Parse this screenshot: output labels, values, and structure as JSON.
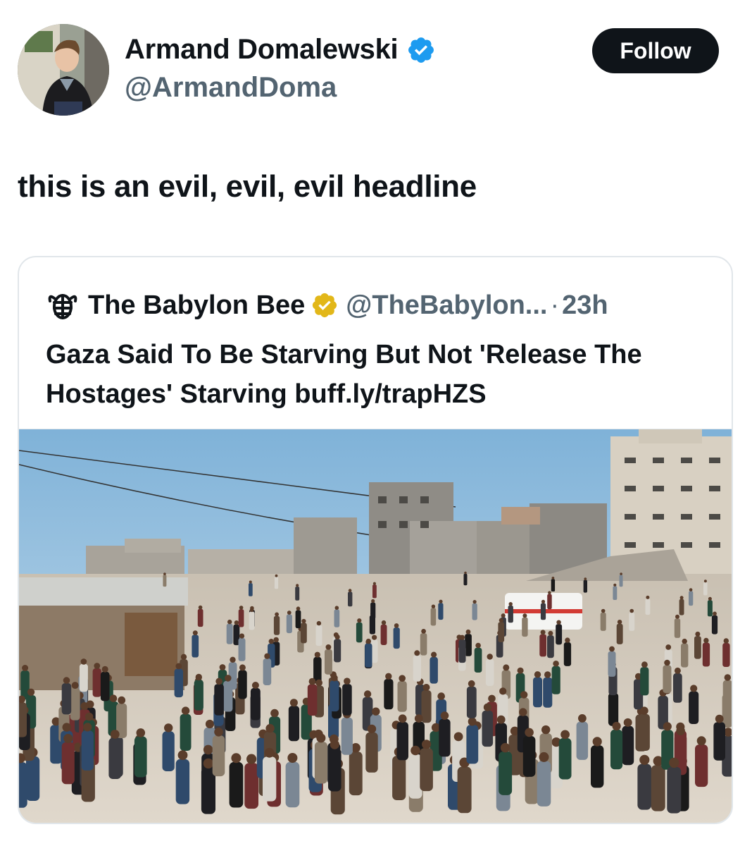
{
  "author": {
    "name": "Armand Domalewski",
    "handle": "@ArmandDoma",
    "verified_badge_icon": "verified-blue-check-icon",
    "avatar_icon": "user-avatar-photo"
  },
  "follow_button": {
    "label": "Follow"
  },
  "tweet": {
    "text": "this is an evil, evil, evil headline"
  },
  "quoted_tweet": {
    "logo_icon": "babylon-bee-logo-icon",
    "name": "The Babylon Bee",
    "verified_badge_icon": "verified-gold-check-icon",
    "handle": "@TheBabylon...",
    "separator": "·",
    "time": "23h",
    "text": "Gaza Said To Be Starving But Not 'Release The Hostages' Starving buff.ly/trapHZS",
    "image_icon": "news-photo-crowd-in-rubble"
  },
  "colors": {
    "text": "#0f1419",
    "secondary_text": "#536471",
    "verified_blue": "#1d9bf0",
    "verified_gold": "#e2b719",
    "button_bg": "#0f1419",
    "border": "#e1e6ea"
  }
}
